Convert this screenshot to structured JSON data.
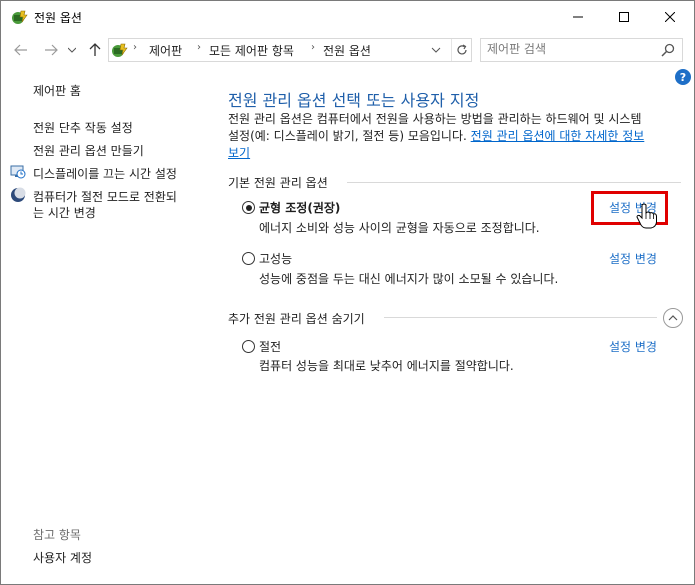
{
  "window": {
    "title": "전원 옵션"
  },
  "nav": {
    "breadcrumb": [
      "제어판",
      "모든 제어판 항목",
      "전원 옵션"
    ],
    "search_placeholder": "제어판 검색"
  },
  "sidebar": {
    "home": "제어판 홈",
    "items": [
      {
        "label": "전원 단추 작동 설정"
      },
      {
        "label": "전원 관리 옵션 만들기"
      },
      {
        "label": "디스플레이를 끄는 시간 설정"
      },
      {
        "label_line1": "컴퓨터가 절전 모드로 전환되",
        "label_line2": "는 시간 변경"
      }
    ],
    "see_also_header": "참고 항목",
    "see_also": [
      "사용자 계정"
    ]
  },
  "main": {
    "title": "전원 관리 옵션 선택 또는 사용자 지정",
    "description_line1": "전원 관리 옵션은 컴퓨터에서 전원을 사용하는 방법을 관리하는 하드웨어 및 시스템",
    "description_line2": "설정(예: 디스플레이 밝기, 절전 등) 모음입니다. ",
    "description_link_a": "전원 관리 옵션에 대한 자세한 정보",
    "description_link_b": "보기",
    "basic_section": "기본 전원 관리 옵션",
    "hidden_section": "추가 전원 관리 옵션 숨기기",
    "plans": [
      {
        "name": "균형 조정(권장)",
        "description": "에너지 소비와 성능 사이의 균형을 자동으로 조정합니다.",
        "selected": true,
        "change_label": "설정 변경"
      },
      {
        "name": "고성능",
        "description": "성능에 중점을 두는 대신 에너지가 많이 소모될 수 있습니다.",
        "selected": false,
        "change_label": "설정 변경"
      },
      {
        "name": "절전",
        "description": "컴퓨터 성능을 최대로 낮추어 에너지를 절약합니다.",
        "selected": false,
        "change_label": "설정 변경"
      }
    ]
  },
  "colors": {
    "accent": "#1f5faa",
    "link": "#1e6fc7",
    "highlight": "#e00000"
  },
  "icons": [
    "power-options-icon",
    "minimize-icon",
    "maximize-icon",
    "close-icon",
    "back-arrow-icon",
    "forward-arrow-icon",
    "recent-dropdown-icon",
    "up-arrow-icon",
    "refresh-icon",
    "search-icon",
    "help-icon",
    "monitor-clock-icon",
    "moon-icon",
    "collapse-chevron-icon",
    "hand-cursor-icon"
  ]
}
